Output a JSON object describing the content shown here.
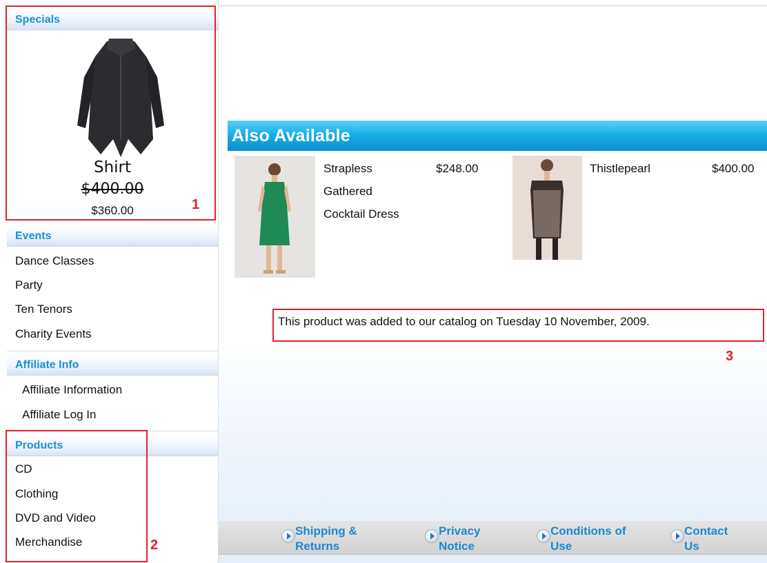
{
  "sidebar": {
    "specials": {
      "header": "Specials",
      "product_name": "Shirt",
      "old_price": "$400.00",
      "new_price": "$360.00"
    },
    "events": {
      "header": "Events",
      "items": [
        "Dance Classes",
        "Party",
        "Ten Tenors",
        "Charity Events"
      ]
    },
    "affiliate": {
      "header": "Affiliate Info",
      "items": [
        "Affiliate Information",
        "Affiliate Log In"
      ]
    },
    "products": {
      "header": "Products",
      "items": [
        "CD",
        "Clothing",
        "DVD and Video",
        "Merchandise"
      ]
    }
  },
  "main": {
    "also_available": {
      "title": "Also Available",
      "products": [
        {
          "name": "Strapless\nGathered\nCocktail Dress",
          "price": "$248.00"
        },
        {
          "name": "Thistlepearl",
          "price": "$400.00"
        }
      ]
    },
    "catalog_note": "This product was added to our catalog on Tuesday 10 November, 2009."
  },
  "footer": {
    "links": [
      "Shipping &\nReturns",
      "Privacy\nNotice",
      "Conditions of\nUse",
      "Contact\nUs"
    ]
  },
  "annotations": [
    "1",
    "2",
    "3"
  ],
  "colors": {
    "accent": "#1a90d8",
    "bar_top": "#5ed0f5",
    "bar_bottom": "#0b8fcf",
    "annotation_red": "#e0202e"
  },
  "icons": [
    "shirt-image",
    "green-dress-image",
    "black-dress-image",
    "footer-arrow-icon"
  ]
}
